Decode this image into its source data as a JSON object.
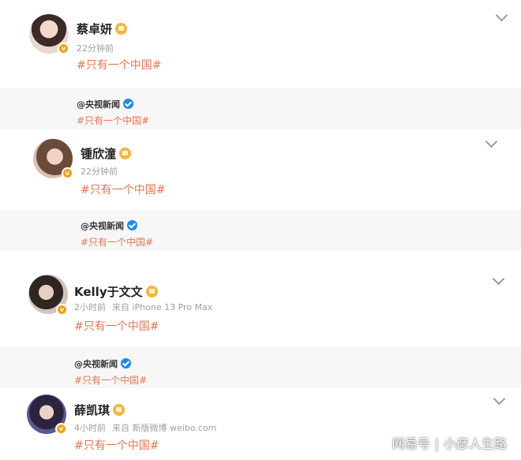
{
  "colors": {
    "topic": "#eb7350",
    "meta": "#a0a0a0",
    "name": "#222222",
    "verified": "#1d8bf1",
    "badge": "#f4a012",
    "repost_bg": "#f7f7f7"
  },
  "posts": [
    {
      "name": "蔡卓妍",
      "time": "22分钟前",
      "source": "",
      "content": "#只有一个中国#",
      "avatar_icon": "avatar",
      "badge_icon": "vip-crown-icon",
      "repost": {
        "user": "@央视新闻",
        "text": "#只有一个中国#"
      }
    },
    {
      "name": "锺欣潼",
      "time": "22分钟前",
      "source": "",
      "content": "#只有一个中国#",
      "avatar_icon": "avatar",
      "badge_icon": "vip-crown-icon",
      "repost": {
        "user": "@央视新闻",
        "text": "#只有一个中国#"
      }
    },
    {
      "name": "Kelly于文文",
      "time": "2小时前",
      "source": "来自 iPhone 13 Pro Max",
      "content": "#只有一个中国#",
      "avatar_icon": "avatar",
      "badge_icon": "vip-crown-icon",
      "repost": {
        "user": "@央视新闻",
        "text": "#只有一个中国#"
      }
    },
    {
      "name": "薛凯琪",
      "time": "4小时前",
      "source": "来自 新版微博 weibo.com",
      "content": "#只有一个中国#",
      "avatar_icon": "avatar",
      "badge_icon": "vip-crown-icon",
      "repost": null
    }
  ],
  "watermark": {
    "left": "网易号",
    "divider": "|",
    "right": "小彦人生路"
  }
}
